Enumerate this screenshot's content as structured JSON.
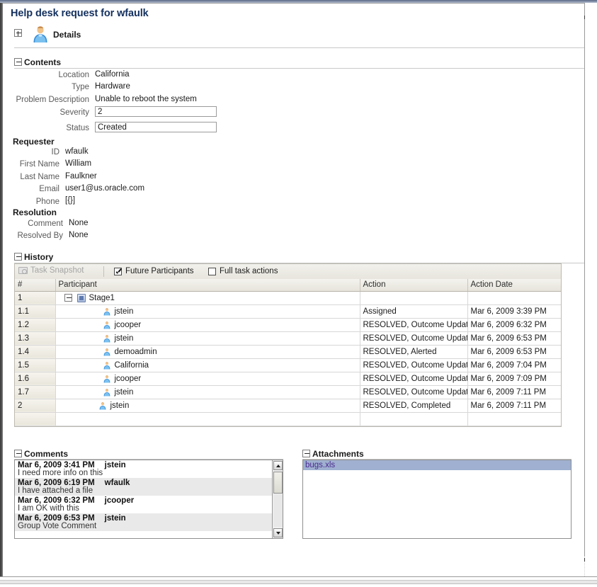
{
  "page": {
    "title": "Help desk request for wfaulk",
    "details_label": "Details",
    "details_icon": "user-icon",
    "expand_icon": "plus-box-icon"
  },
  "contents": {
    "header": "Contents",
    "fields": [
      {
        "label": "Location",
        "value": "California",
        "type": "text"
      },
      {
        "label": "Type",
        "value": "Hardware",
        "type": "text"
      },
      {
        "label": "Problem Description",
        "value": "Unable to reboot the system",
        "type": "text"
      },
      {
        "label": "Severity",
        "value": "2",
        "type": "input"
      },
      {
        "label": "Status",
        "value": "Created",
        "type": "input"
      }
    ]
  },
  "requester": {
    "header": "Requester",
    "fields": [
      {
        "label": "ID",
        "value": "wfaulk"
      },
      {
        "label": "First Name",
        "value": "William"
      },
      {
        "label": "Last Name",
        "value": "Faulkner"
      },
      {
        "label": "Email",
        "value": "user1@us.oracle.com"
      },
      {
        "label": "Phone",
        "value": "[{}]"
      }
    ]
  },
  "resolution": {
    "header": "Resolution",
    "fields": [
      {
        "label": "Comment",
        "value": "None"
      },
      {
        "label": "Resolved By",
        "value": "None"
      }
    ]
  },
  "history": {
    "header": "History",
    "toolbar": {
      "snapshot_label": "Task Snapshot",
      "snapshot_icon": "camera-icon",
      "snapshot_disabled": true,
      "future_participants_label": "Future Participants",
      "future_participants_checked": true,
      "full_task_actions_label": "Full task actions",
      "full_task_actions_checked": false
    },
    "columns": [
      "#",
      "Participant",
      "Action",
      "Action Date"
    ],
    "rows": [
      {
        "num": "1",
        "participant": "Stage1",
        "icon": "stage-icon",
        "indent": 0,
        "action": "",
        "date": ""
      },
      {
        "num": "1.1",
        "participant": "jstein",
        "icon": "user-icon",
        "indent": 2,
        "action": "Assigned",
        "date": "Mar 6, 2009 3:39 PM"
      },
      {
        "num": "1.2",
        "participant": "jcooper",
        "icon": "user-icon",
        "indent": 2,
        "action": "RESOLVED, Outcome Updated",
        "date": "Mar 6, 2009 6:32 PM"
      },
      {
        "num": "1.3",
        "participant": "jstein",
        "icon": "user-icon",
        "indent": 2,
        "action": "RESOLVED, Outcome Updated",
        "date": "Mar 6, 2009 6:53 PM"
      },
      {
        "num": "1.4",
        "participant": "demoadmin",
        "icon": "user-icon",
        "indent": 2,
        "action": "RESOLVED, Alerted",
        "date": "Mar 6, 2009 6:53 PM"
      },
      {
        "num": "1.5",
        "participant": "California",
        "icon": "user-icon",
        "indent": 2,
        "action": "RESOLVED, Outcome Updated",
        "date": "Mar 6, 2009 7:04 PM"
      },
      {
        "num": "1.6",
        "participant": "jcooper",
        "icon": "user-icon",
        "indent": 2,
        "action": "RESOLVED, Outcome Updated",
        "date": "Mar 6, 2009 7:09 PM"
      },
      {
        "num": "1.7",
        "participant": "jstein",
        "icon": "user-icon",
        "indent": 2,
        "action": "RESOLVED, Outcome Updated",
        "date": "Mar 6, 2009 7:11 PM"
      },
      {
        "num": "2",
        "participant": "jstein",
        "icon": "user-icon",
        "indent": 1,
        "action": "RESOLVED, Completed",
        "date": "Mar 6, 2009 7:11 PM"
      },
      {
        "num": "",
        "participant": "",
        "icon": "",
        "indent": 0,
        "action": "",
        "date": ""
      }
    ]
  },
  "comments": {
    "header": "Comments",
    "items": [
      {
        "timestamp": "Mar 6, 2009 3:41 PM",
        "author": "jstein",
        "text": "I need more info on this"
      },
      {
        "timestamp": "Mar 6, 2009 6:19 PM",
        "author": "wfaulk",
        "text": "I have attached a file"
      },
      {
        "timestamp": "Mar 6, 2009 6:32 PM",
        "author": "jcooper",
        "text": "I am OK with this"
      },
      {
        "timestamp": "Mar 6, 2009 6:53 PM",
        "author": "jstein",
        "text": "Group Vote Comment"
      }
    ]
  },
  "attachments": {
    "header": "Attachments",
    "items": [
      {
        "name": "bugs.xls",
        "selected": true
      }
    ]
  },
  "colors": {
    "title": "#13305e",
    "label": "#5a5a5a",
    "link": "#4b2b8f",
    "selection": "#9fb0d0"
  }
}
